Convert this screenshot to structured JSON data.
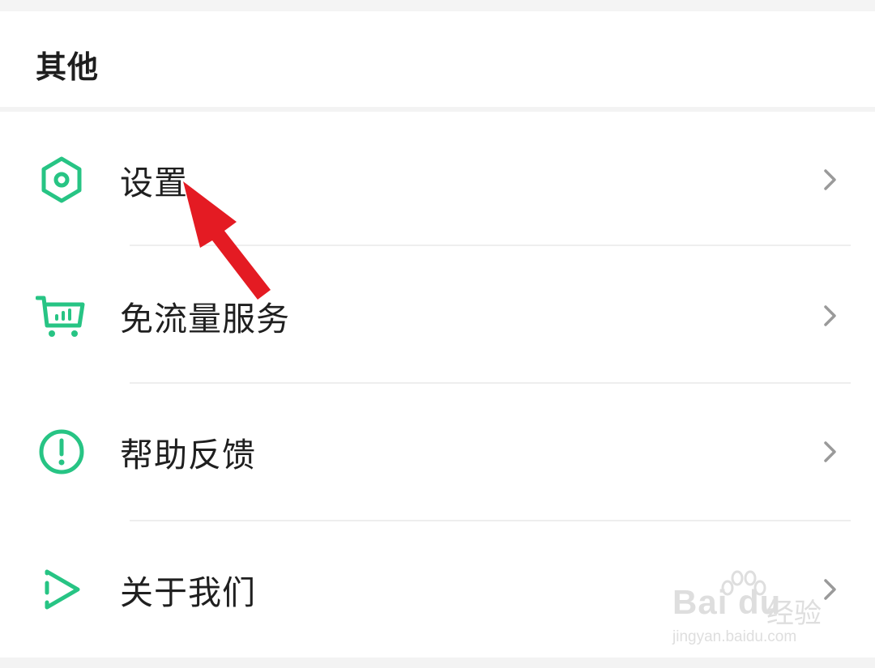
{
  "header": {
    "title": "其他"
  },
  "menu": {
    "items": [
      {
        "label": "设置",
        "icon": "settings-hexagon-icon"
      },
      {
        "label": "免流量服务",
        "icon": "cart-icon"
      },
      {
        "label": "帮助反馈",
        "icon": "exclamation-circle-icon"
      },
      {
        "label": "关于我们",
        "icon": "play-triangle-icon"
      }
    ]
  },
  "watermark": {
    "brand": "Bai du",
    "brand_cn": "经验",
    "url": "jingyan.baidu.com"
  },
  "colors": {
    "accent": "#27c484",
    "annotation_arrow": "#e41b23",
    "text": "#1f1f1f",
    "chevron": "#9a9a9a"
  }
}
